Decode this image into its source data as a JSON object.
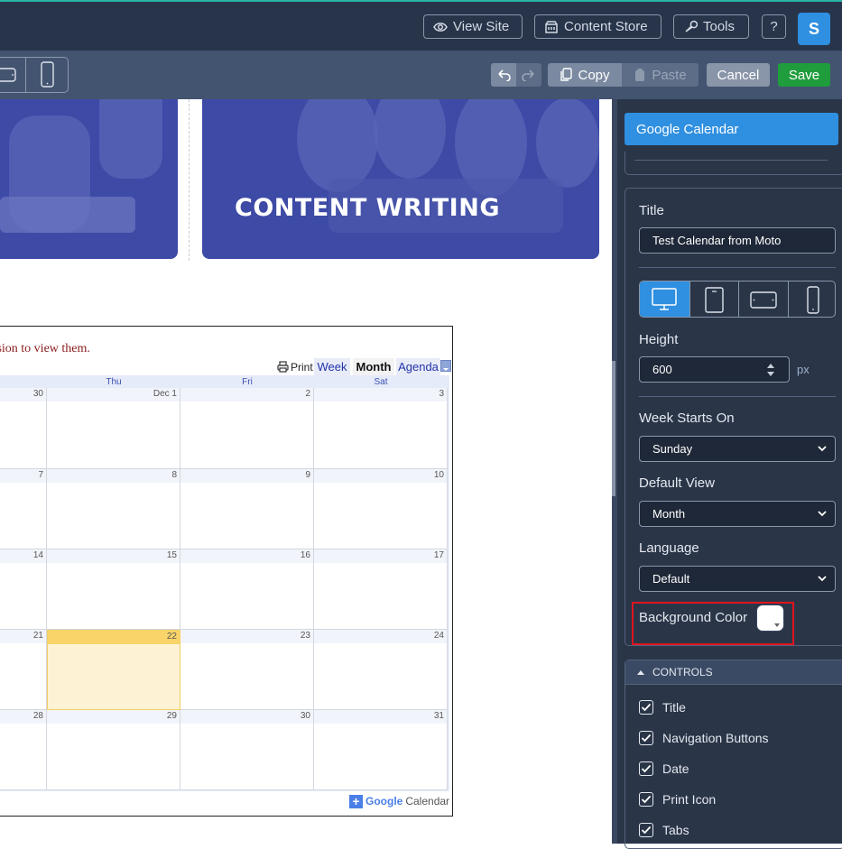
{
  "topbar": {
    "view_site": "View Site",
    "content_store": "Content Store",
    "tools": "Tools",
    "help": "?",
    "avatar": "S"
  },
  "toolbar": {
    "copy": "Copy",
    "paste": "Paste",
    "cancel": "Cancel",
    "save": "Save"
  },
  "hero": {
    "title": "CONTENT WRITING"
  },
  "calendar": {
    "message": "ssion to view them.",
    "print": "Print",
    "tabs": [
      "Week",
      "Month",
      "Agenda"
    ],
    "days_of_week": [
      "Thu",
      "Fri",
      "Sat"
    ],
    "weeks": [
      [
        "30",
        "Dec 1",
        "2",
        "3"
      ],
      [
        "7",
        "8",
        "9",
        "10"
      ],
      [
        "14",
        "15",
        "16",
        "17"
      ],
      [
        "21",
        "22",
        "23",
        "24"
      ],
      [
        "28",
        "29",
        "30",
        "31"
      ]
    ],
    "google": "Google",
    "calendar_word": "Calendar"
  },
  "panel": {
    "widget_title": "Google Calendar",
    "title_label": "Title",
    "title_value": "Test Calendar from Moto",
    "height_label": "Height",
    "height_value": "600",
    "height_unit": "px",
    "week_starts_label": "Week Starts On",
    "week_starts_value": "Sunday",
    "default_view_label": "Default View",
    "default_view_value": "Month",
    "language_label": "Language",
    "language_value": "Default",
    "bg_color_label": "Background Color",
    "bg_color_value": "#ffffff",
    "controls_heading": "CONTROLS",
    "controls": [
      "Title",
      "Navigation Buttons",
      "Date",
      "Print Icon",
      "Tabs"
    ]
  },
  "colors": {
    "accent": "#2f8fe0",
    "save": "#1f9d3c",
    "today": "#fdf3d4",
    "hero": "#3d4aa6",
    "highlight_box": "#e0141e"
  }
}
